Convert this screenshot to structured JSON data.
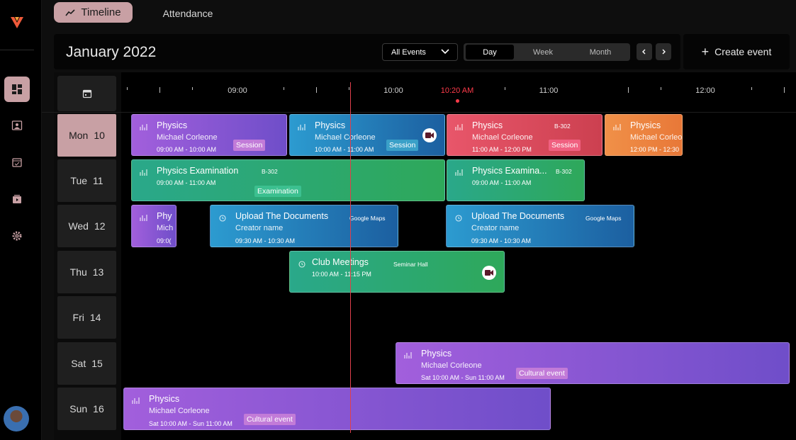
{
  "tabs": {
    "timeline": "Timeline",
    "attendance": "Attendance"
  },
  "header": {
    "month": "January 2022",
    "filter": "All Events",
    "views": [
      "Day",
      "Week",
      "Month"
    ],
    "active_view": "Day"
  },
  "create_label": "Create event",
  "timeline": {
    "hours": [
      "09:00",
      "10:00",
      "11:00",
      "12:00"
    ],
    "now_label": "10:20 AM"
  },
  "days": [
    {
      "name": "Mon",
      "num": "10"
    },
    {
      "name": "Tue",
      "num": "11"
    },
    {
      "name": "Wed",
      "num": "12"
    },
    {
      "name": "Thu",
      "num": "13"
    },
    {
      "name": "Fri",
      "num": "14"
    },
    {
      "name": "Sat",
      "num": "15"
    },
    {
      "name": "Sun",
      "num": "16"
    }
  ],
  "events": {
    "mon1": {
      "title": "Physics",
      "sub": "Michael Corleone",
      "time": "09:00 AM - 10:00 AM",
      "badge": "Session"
    },
    "mon2": {
      "title": "Physics",
      "sub": "Michael Corleone",
      "time": "10:00 AM - 11:00 AM",
      "badge": "Session"
    },
    "mon3": {
      "title": "Physics",
      "sub": "Michael Corleone",
      "time": "11:00 AM - 12:00 PM",
      "room": "B-302",
      "badge": "Session"
    },
    "mon4": {
      "title": "Physics",
      "sub": "Michael Corleo",
      "time": "12:00 PM - 12:30"
    },
    "tue1": {
      "title": "Physics Examination",
      "room": "B-302",
      "time": "09:00 AM - 11:00 AM",
      "badge": "Examination"
    },
    "tue2": {
      "title": "Physics Examina...",
      "room": "B-302",
      "time": "09:00 AM - 11:00 AM"
    },
    "wed1": {
      "title": "Phy",
      "sub": "Mich",
      "time": "09:0("
    },
    "wed2": {
      "title": "Upload The Documents",
      "sub": "Creator name",
      "room": "Google Maps",
      "time": "09:30 AM - 10:30 AM"
    },
    "wed3": {
      "title": "Upload The Documents",
      "sub": "Creator name",
      "room": "Google Maps",
      "time": "09:30 AM - 10:30 AM"
    },
    "thu1": {
      "title": "Club Meetings",
      "room": "Seminar Hall",
      "time": "10:00 AM - 11:15 PM"
    },
    "sat1": {
      "title": "Physics",
      "sub": "Michael Corleone",
      "time": "Sat 10:00 AM - Sun 11:00 AM",
      "badge": "Cultural event"
    },
    "sun1": {
      "title": "Physics",
      "sub": "Michael Corleone",
      "time": "Sat 10:00 AM - Sun 11:00 AM",
      "badge": "Cultural event"
    }
  }
}
